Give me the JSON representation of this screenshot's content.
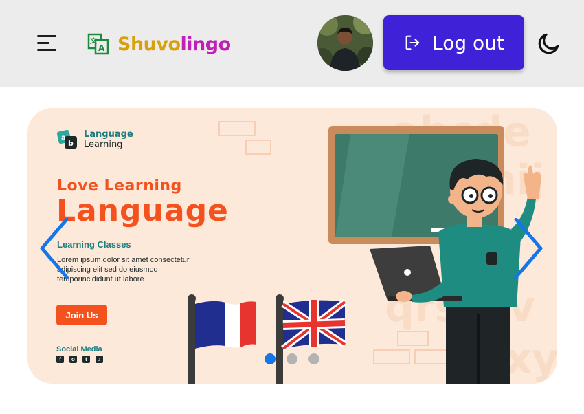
{
  "header": {
    "menu_icon": "hamburger-menu-icon",
    "brand": {
      "icon": "translate-icon",
      "part1": "Shuvo",
      "part2": "lingo",
      "color1": "#d8a00b",
      "color2": "#c21fb4"
    },
    "avatar_icon": "user-avatar",
    "logout": {
      "label": "Log out",
      "icon": "logout-icon",
      "bg": "#3f22d8"
    },
    "theme_toggle_icon": "moon-icon"
  },
  "carousel": {
    "slide": {
      "logo_line1": "Language",
      "logo_line2": "Learning",
      "headline1": "Love Learning",
      "headline2": "Language",
      "section_title": "Learning Classes",
      "body": "Lorem ipsum dolor sit amet consectetur adipiscing elit sed do eiusmod temporincididunt ut labore",
      "cta": "Join Us",
      "social_title": "Social Media",
      "social_icons": [
        "facebook-icon",
        "instagram-icon",
        "twitter-icon",
        "tiktok-icon"
      ],
      "accent": "#f3521e",
      "teal": "#1d7d80",
      "bg": "#fde9da"
    },
    "prev_icon": "chevron-left-icon",
    "next_icon": "chevron-right-icon",
    "arrow_color": "#1476e8",
    "dots_count": 3,
    "active_dot": 1
  }
}
